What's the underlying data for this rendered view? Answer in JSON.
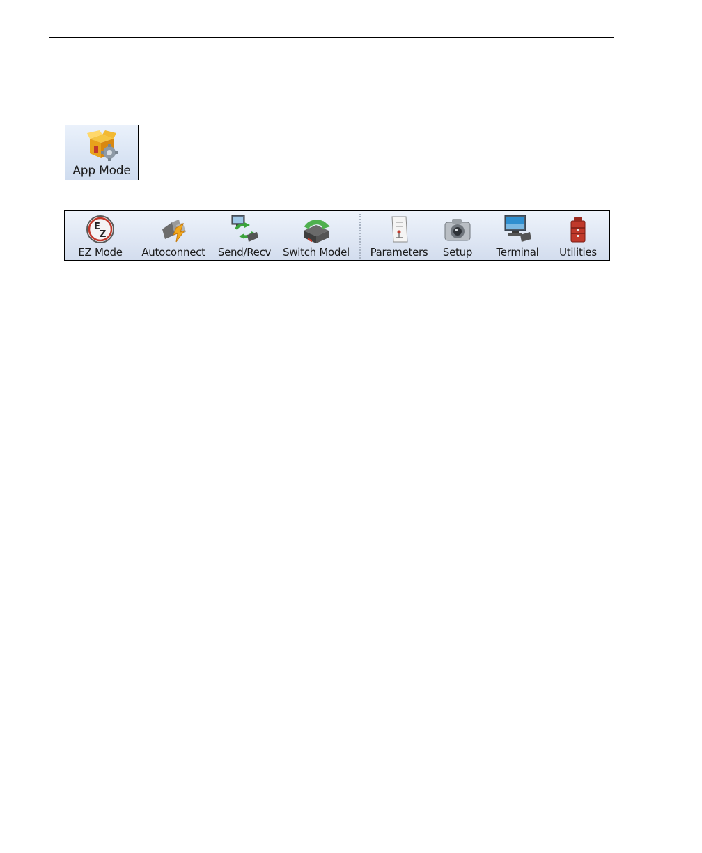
{
  "app_mode": {
    "label": "App Mode",
    "icon": "app-mode-box-gear-icon"
  },
  "toolbar": {
    "items": [
      {
        "label": "EZ Mode",
        "icon": "ez-mode-icon"
      },
      {
        "label": "Autoconnect",
        "icon": "plug-connect-icon"
      },
      {
        "label": "Send/Recv",
        "icon": "send-receive-icon"
      },
      {
        "label": "Switch Model",
        "icon": "switch-model-icon"
      },
      {
        "label": "Parameters",
        "icon": "parameters-document-icon"
      },
      {
        "label": "Setup",
        "icon": "camera-setup-icon"
      },
      {
        "label": "Terminal",
        "icon": "terminal-monitor-icon"
      },
      {
        "label": "Utilities",
        "icon": "toolbox-icon"
      }
    ]
  }
}
